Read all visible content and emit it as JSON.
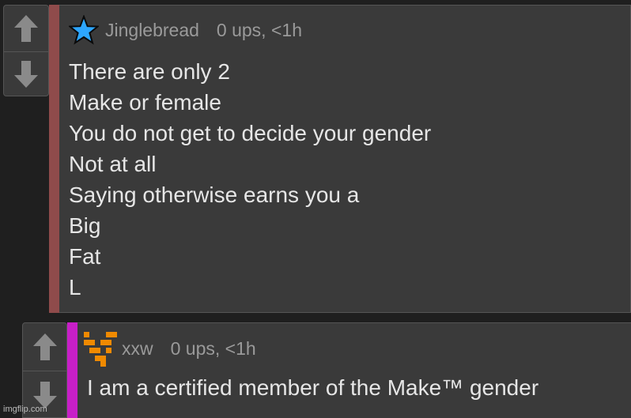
{
  "comment_1": {
    "username": "Jinglebread",
    "meta": "0 ups, <1h",
    "badge_icon": "blue-star-icon",
    "thread_color": "#8f4b4b",
    "lines": [
      "There are only 2",
      "Make or female",
      "You do not get to decide your gender",
      "Not at all",
      "Saying otherwise earns you a",
      "Big",
      "Fat",
      "L"
    ]
  },
  "comment_2": {
    "username": "xxw",
    "meta": "0 ups, <1h",
    "avatar_icon": "pixel-avatar-icon",
    "thread_color": "#c81fc8",
    "text": "I am a certified member of the Make™ gender"
  },
  "watermark": "imgflip.com"
}
